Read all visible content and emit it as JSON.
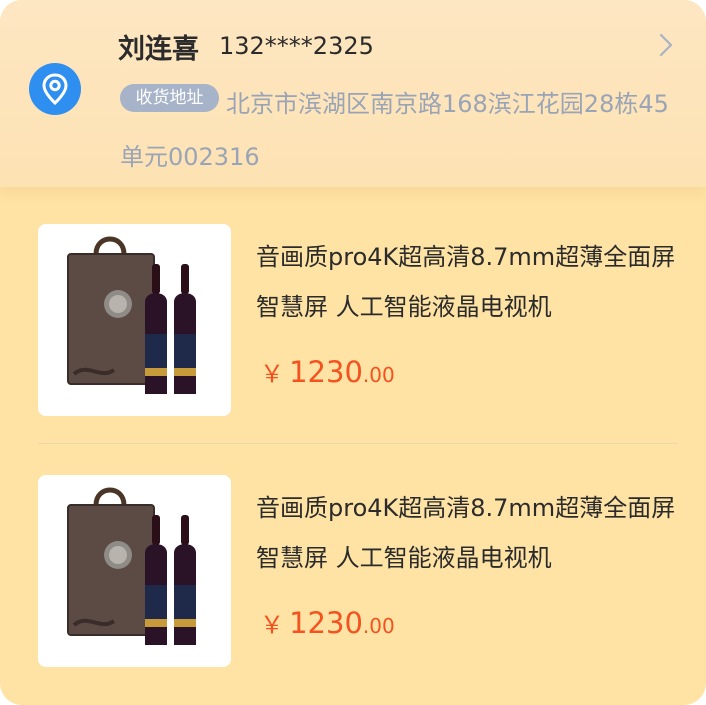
{
  "address": {
    "name": "刘连喜",
    "phone": "132****2325",
    "tag": "收货地址",
    "text": "北京市滨湖区南京路168滨江花园28栋45单元002316"
  },
  "products": [
    {
      "title": "音画质pro4K超高清8.7mm超薄全面屏 智慧屏 人工智能液晶电视机",
      "currency": "￥",
      "price_int": "1230",
      "price_dec": ".00"
    },
    {
      "title": "音画质pro4K超高清8.7mm超薄全面屏 智慧屏 人工智能液晶电视机",
      "currency": "￥",
      "price_int": "1230",
      "price_dec": ".00"
    }
  ],
  "colors": {
    "background": "#fee3a5",
    "accent_blue": "#2f8ff0",
    "price": "#f4521f",
    "tag_bg": "#a7b3c8",
    "address_text": "#9aa4b7"
  },
  "icons": [
    "location-pin-icon",
    "chevron-right-icon"
  ]
}
